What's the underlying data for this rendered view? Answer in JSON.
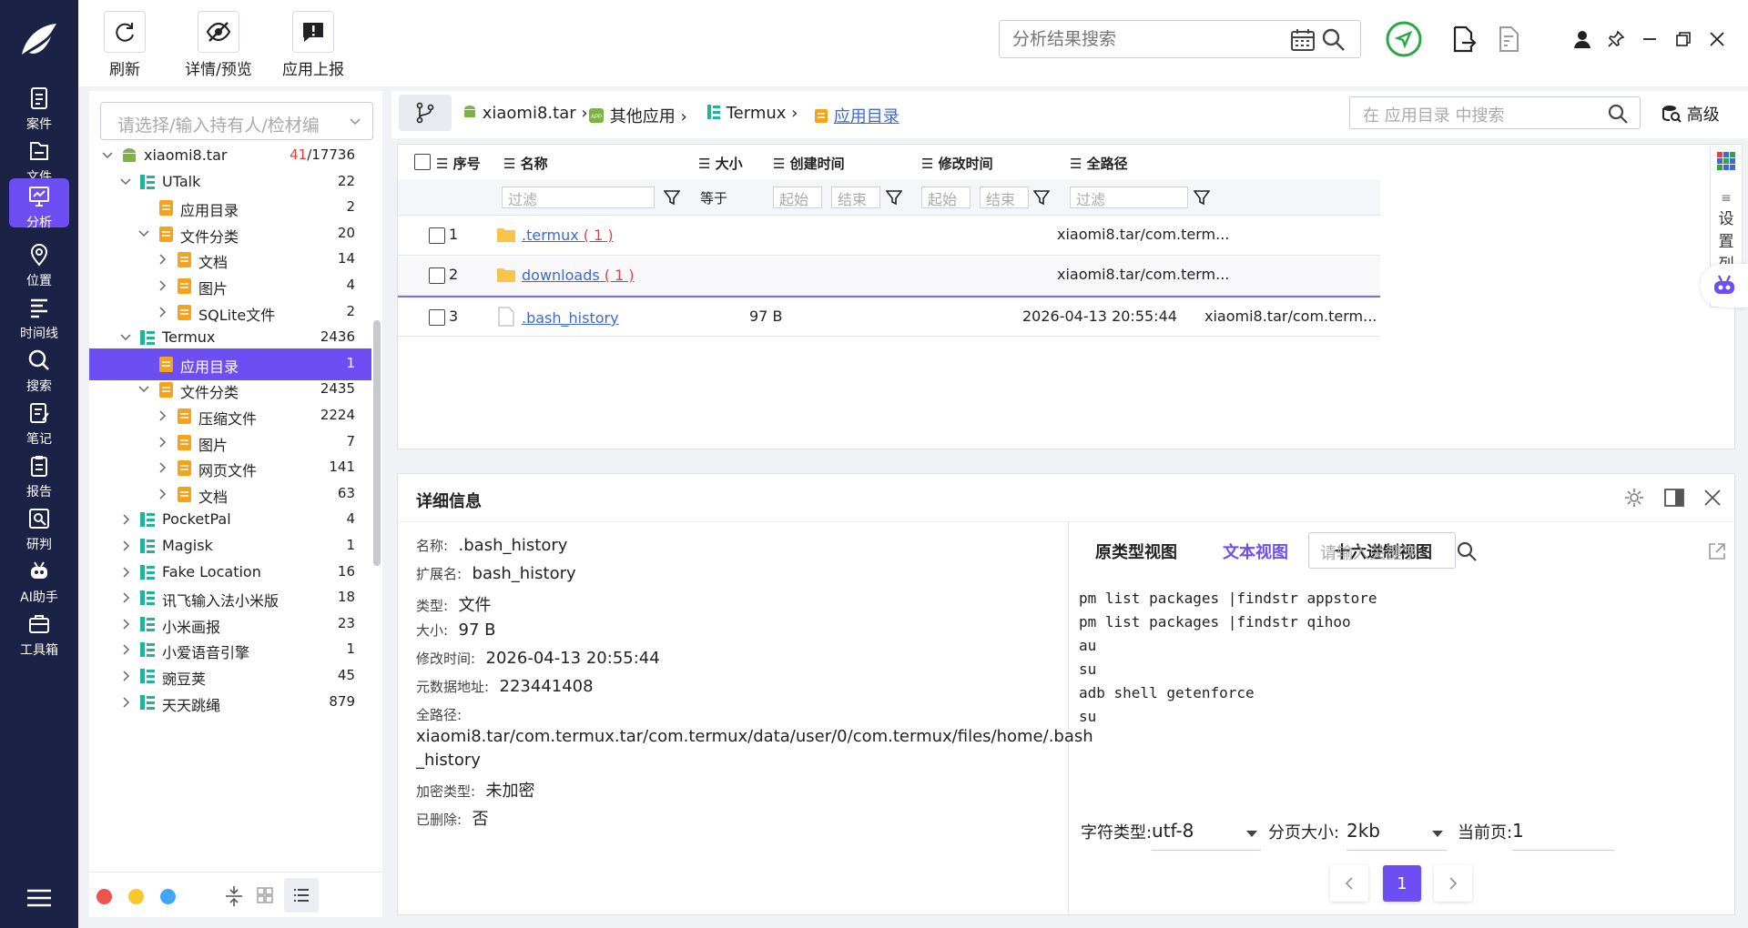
{
  "nav": {
    "items": [
      {
        "label": "案件",
        "icon": "case-icon"
      },
      {
        "label": "文件",
        "icon": "file-icon"
      },
      {
        "label": "分析",
        "icon": "analysis-icon"
      },
      {
        "label": "位置",
        "icon": "location-icon"
      },
      {
        "label": "时间线",
        "icon": "timeline-icon"
      },
      {
        "label": "搜索",
        "icon": "search-icon"
      },
      {
        "label": "笔记",
        "icon": "note-icon"
      },
      {
        "label": "报告",
        "icon": "report-icon"
      },
      {
        "label": "研判",
        "icon": "judge-icon"
      },
      {
        "label": "AI助手",
        "icon": "robot-icon"
      },
      {
        "label": "工具箱",
        "icon": "toolbox-icon"
      }
    ],
    "active": "分析"
  },
  "toolbar": {
    "refresh": "刷新",
    "preview": "详情/预览",
    "report": "应用上报",
    "search_placeholder": "分析结果搜索"
  },
  "tree": {
    "select_placeholder": "请选择/输入持有人/检材编",
    "rows": [
      {
        "label": "xiaomi8.tar",
        "count_red": "41",
        "count": "/17736"
      },
      {
        "label": "UTalk",
        "count": "22"
      },
      {
        "label": "应用目录",
        "count": "2"
      },
      {
        "label": "文件分类",
        "count": "20"
      },
      {
        "label": "文档",
        "count": "14"
      },
      {
        "label": "图片",
        "count": "4"
      },
      {
        "label": "SQLite文件",
        "count": "2"
      },
      {
        "label": "Termux",
        "count": "2436"
      },
      {
        "label": "应用目录",
        "count": "1"
      },
      {
        "label": "文件分类",
        "count": "2435"
      },
      {
        "label": "压缩文件",
        "count": "2224"
      },
      {
        "label": "图片",
        "count": "7"
      },
      {
        "label": "网页文件",
        "count": "141"
      },
      {
        "label": "文档",
        "count": "63"
      },
      {
        "label": "PocketPal",
        "count": "4"
      },
      {
        "label": "Magisk",
        "count": "1"
      },
      {
        "label": "Fake Location",
        "count": "16"
      },
      {
        "label": "讯飞输入法小米版",
        "count": "18"
      },
      {
        "label": "小米画报",
        "count": "23"
      },
      {
        "label": "小爱语音引擎",
        "count": "1"
      },
      {
        "label": "豌豆荚",
        "count": "45"
      },
      {
        "label": "天天跳绳",
        "count": "879"
      }
    ]
  },
  "breadcrumb": [
    "xiaomi8.tar",
    "其他应用",
    "Termux",
    "应用目录"
  ],
  "path_search_placeholder": "在 应用目录 中搜索",
  "advanced_label": "高级",
  "table": {
    "headers": [
      "序号",
      "名称",
      "大小",
      "创建时间",
      "修改时间",
      "全路径"
    ],
    "filter": {
      "placeholder": "过滤",
      "equal": "等于",
      "start": "起始",
      "end": "结束"
    },
    "rows": [
      {
        "index": "1",
        "name": ".termux",
        "badge": "( 1 )",
        "size": "",
        "mtime": "",
        "path": "xiaomi8.tar/com.term..."
      },
      {
        "index": "2",
        "name": "downloads",
        "badge": "( 1 )",
        "size": "",
        "mtime": "",
        "path": "xiaomi8.tar/com.term..."
      },
      {
        "index": "3",
        "name": ".bash_history",
        "badge": "",
        "size": "97 B",
        "mtime": "2026-04-13 20:55:44",
        "path": "xiaomi8.tar/com.term..."
      }
    ]
  },
  "settings_col": {
    "chars": [
      "设",
      "置",
      "列"
    ]
  },
  "detail": {
    "title": "详细信息",
    "fields": [
      {
        "k": "名称:",
        "v": ".bash_history"
      },
      {
        "k": "扩展名:",
        "v": "bash_history"
      },
      {
        "k": "类型:",
        "v": "文件"
      },
      {
        "k": "大小:",
        "v": "97 B"
      },
      {
        "k": "修改时间:",
        "v": "2026-04-13 20:55:44"
      },
      {
        "k": "元数据地址:",
        "v": "223441408"
      },
      {
        "k": "全路径:",
        "v": ""
      }
    ],
    "fullpath_line1": "xiaomi8.tar/com.termux.tar/com.termux/data/user/0/com.termux/files/home/.bash",
    "fullpath_line2": "_history",
    "encrypt": {
      "k": "加密类型:",
      "v": "未加密"
    },
    "deleted": {
      "k": "已删除:",
      "v": "否"
    },
    "view_tabs": [
      "原类型视图",
      "文本视图",
      "十六进制视图"
    ],
    "keyword_placeholder": "请输入关键字",
    "code": "pm list packages |findstr appstore\npm list packages |findstr qihoo\nau\nsu\nadb shell getenforce\nsu",
    "charset": {
      "label": "字符类型:",
      "value": "utf-8"
    },
    "pagesize": {
      "label": "分页大小:",
      "value": "2kb"
    },
    "curpage": {
      "label": "当前页:",
      "value": "1"
    },
    "page": "1"
  },
  "colors": {
    "accent": "#6d4ef2",
    "nav_bg": "#1b2245",
    "link": "#3e67d8",
    "red": "#e84040"
  }
}
